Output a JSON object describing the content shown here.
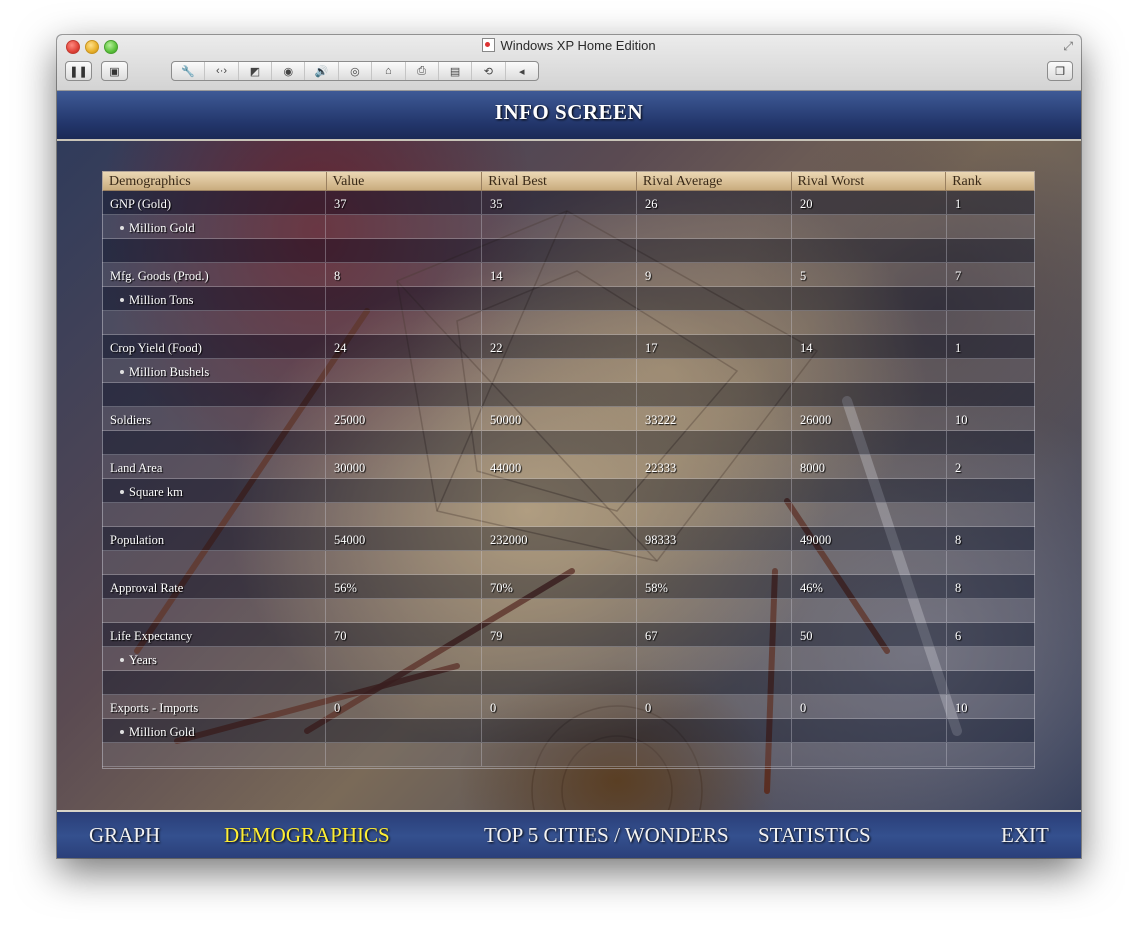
{
  "window": {
    "title": "Windows XP Home Edition"
  },
  "toolbar": {
    "left_buttons": [
      {
        "name": "pause-icon",
        "glyph": "❚❚"
      },
      {
        "name": "screenshot-icon",
        "glyph": "▣"
      }
    ],
    "group_buttons": [
      {
        "name": "wrench-icon",
        "glyph": "🔧"
      },
      {
        "name": "network-icon",
        "glyph": "‹·›"
      },
      {
        "name": "disk-icon",
        "glyph": "◩"
      },
      {
        "name": "cd-icon",
        "glyph": "◉"
      },
      {
        "name": "sound-icon",
        "glyph": "🔊"
      },
      {
        "name": "camera-icon",
        "glyph": "◎"
      },
      {
        "name": "usb-icon",
        "glyph": "⌂"
      },
      {
        "name": "printer-icon",
        "glyph": "⎙"
      },
      {
        "name": "drive-icon",
        "glyph": "▤"
      },
      {
        "name": "sync-icon",
        "glyph": "⟲"
      },
      {
        "name": "collapse-arrow-icon",
        "glyph": "◂"
      }
    ],
    "right_button": {
      "name": "window-icon",
      "glyph": "❐"
    }
  },
  "header": {
    "title": "INFO SCREEN"
  },
  "table": {
    "columns": [
      "Demographics",
      "Value",
      "Rival Best",
      "Rival Average",
      "Rival Worst",
      "Rank"
    ],
    "rows": [
      {
        "cells": [
          "GNP (Gold)",
          "37",
          "35",
          "26",
          "20",
          "1"
        ],
        "sub": false
      },
      {
        "cells": [
          "Million Gold",
          "",
          "",
          "",
          "",
          ""
        ],
        "sub": true
      },
      {
        "cells": [
          "",
          "",
          "",
          "",
          "",
          ""
        ],
        "sub": false
      },
      {
        "cells": [
          "Mfg. Goods (Prod.)",
          "8",
          "14",
          "9",
          "5",
          "7"
        ],
        "sub": false
      },
      {
        "cells": [
          "Million Tons",
          "",
          "",
          "",
          "",
          ""
        ],
        "sub": true
      },
      {
        "cells": [
          "",
          "",
          "",
          "",
          "",
          ""
        ],
        "sub": false
      },
      {
        "cells": [
          "Crop Yield (Food)",
          "24",
          "22",
          "17",
          "14",
          "1"
        ],
        "sub": false
      },
      {
        "cells": [
          "Million Bushels",
          "",
          "",
          "",
          "",
          ""
        ],
        "sub": true
      },
      {
        "cells": [
          "",
          "",
          "",
          "",
          "",
          ""
        ],
        "sub": false
      },
      {
        "cells": [
          "Soldiers",
          "25000",
          "50000",
          "33222",
          "26000",
          "10"
        ],
        "sub": false
      },
      {
        "cells": [
          "",
          "",
          "",
          "",
          "",
          ""
        ],
        "sub": false
      },
      {
        "cells": [
          "Land Area",
          "30000",
          "44000",
          "22333",
          "8000",
          "2"
        ],
        "sub": false
      },
      {
        "cells": [
          "Square km",
          "",
          "",
          "",
          "",
          ""
        ],
        "sub": true
      },
      {
        "cells": [
          "",
          "",
          "",
          "",
          "",
          ""
        ],
        "sub": false
      },
      {
        "cells": [
          "Population",
          "54000",
          "232000",
          "98333",
          "49000",
          "8"
        ],
        "sub": false
      },
      {
        "cells": [
          "",
          "",
          "",
          "",
          "",
          ""
        ],
        "sub": false
      },
      {
        "cells": [
          "Approval Rate",
          "56%",
          "70%",
          "58%",
          "46%",
          "8"
        ],
        "sub": false
      },
      {
        "cells": [
          "",
          "",
          "",
          "",
          "",
          ""
        ],
        "sub": false
      },
      {
        "cells": [
          "Life Expectancy",
          "70",
          "79",
          "67",
          "50",
          "6"
        ],
        "sub": false
      },
      {
        "cells": [
          "Years",
          "",
          "",
          "",
          "",
          ""
        ],
        "sub": true
      },
      {
        "cells": [
          "",
          "",
          "",
          "",
          "",
          ""
        ],
        "sub": false
      },
      {
        "cells": [
          "Exports - Imports",
          "0",
          "0",
          "0",
          "0",
          "10"
        ],
        "sub": false
      },
      {
        "cells": [
          "Million Gold",
          "",
          "",
          "",
          "",
          ""
        ],
        "sub": true
      },
      {
        "cells": [
          "",
          "",
          "",
          "",
          "",
          ""
        ],
        "sub": false
      }
    ]
  },
  "nav": {
    "graph": "GRAPH",
    "demographics": "DEMOGRAPHICS",
    "top5": "TOP 5 CITIES / WONDERS",
    "statistics": "STATISTICS",
    "exit": "EXIT"
  },
  "colors": {
    "active_nav": "#ffee33",
    "banner": "#22356a",
    "header_row": "#d9c095"
  }
}
